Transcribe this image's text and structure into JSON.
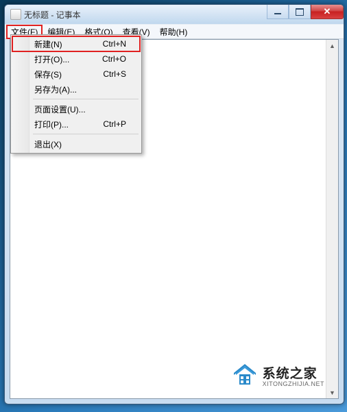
{
  "window": {
    "title": "无标题 - 记事本"
  },
  "menubar": {
    "file": "文件(F)",
    "edit": "编辑(E)",
    "format": "格式(O)",
    "view": "查看(V)",
    "help": "帮助(H)"
  },
  "file_menu": {
    "new_label": "新建(N)",
    "new_shortcut": "Ctrl+N",
    "open_label": "打开(O)...",
    "open_shortcut": "Ctrl+O",
    "save_label": "保存(S)",
    "save_shortcut": "Ctrl+S",
    "saveas_label": "另存为(A)...",
    "pagesetup_label": "页面设置(U)...",
    "print_label": "打印(P)...",
    "print_shortcut": "Ctrl+P",
    "exit_label": "退出(X)"
  },
  "watermark": {
    "cn": "系统之家",
    "en": "XITONGZHIJIA.NET"
  }
}
